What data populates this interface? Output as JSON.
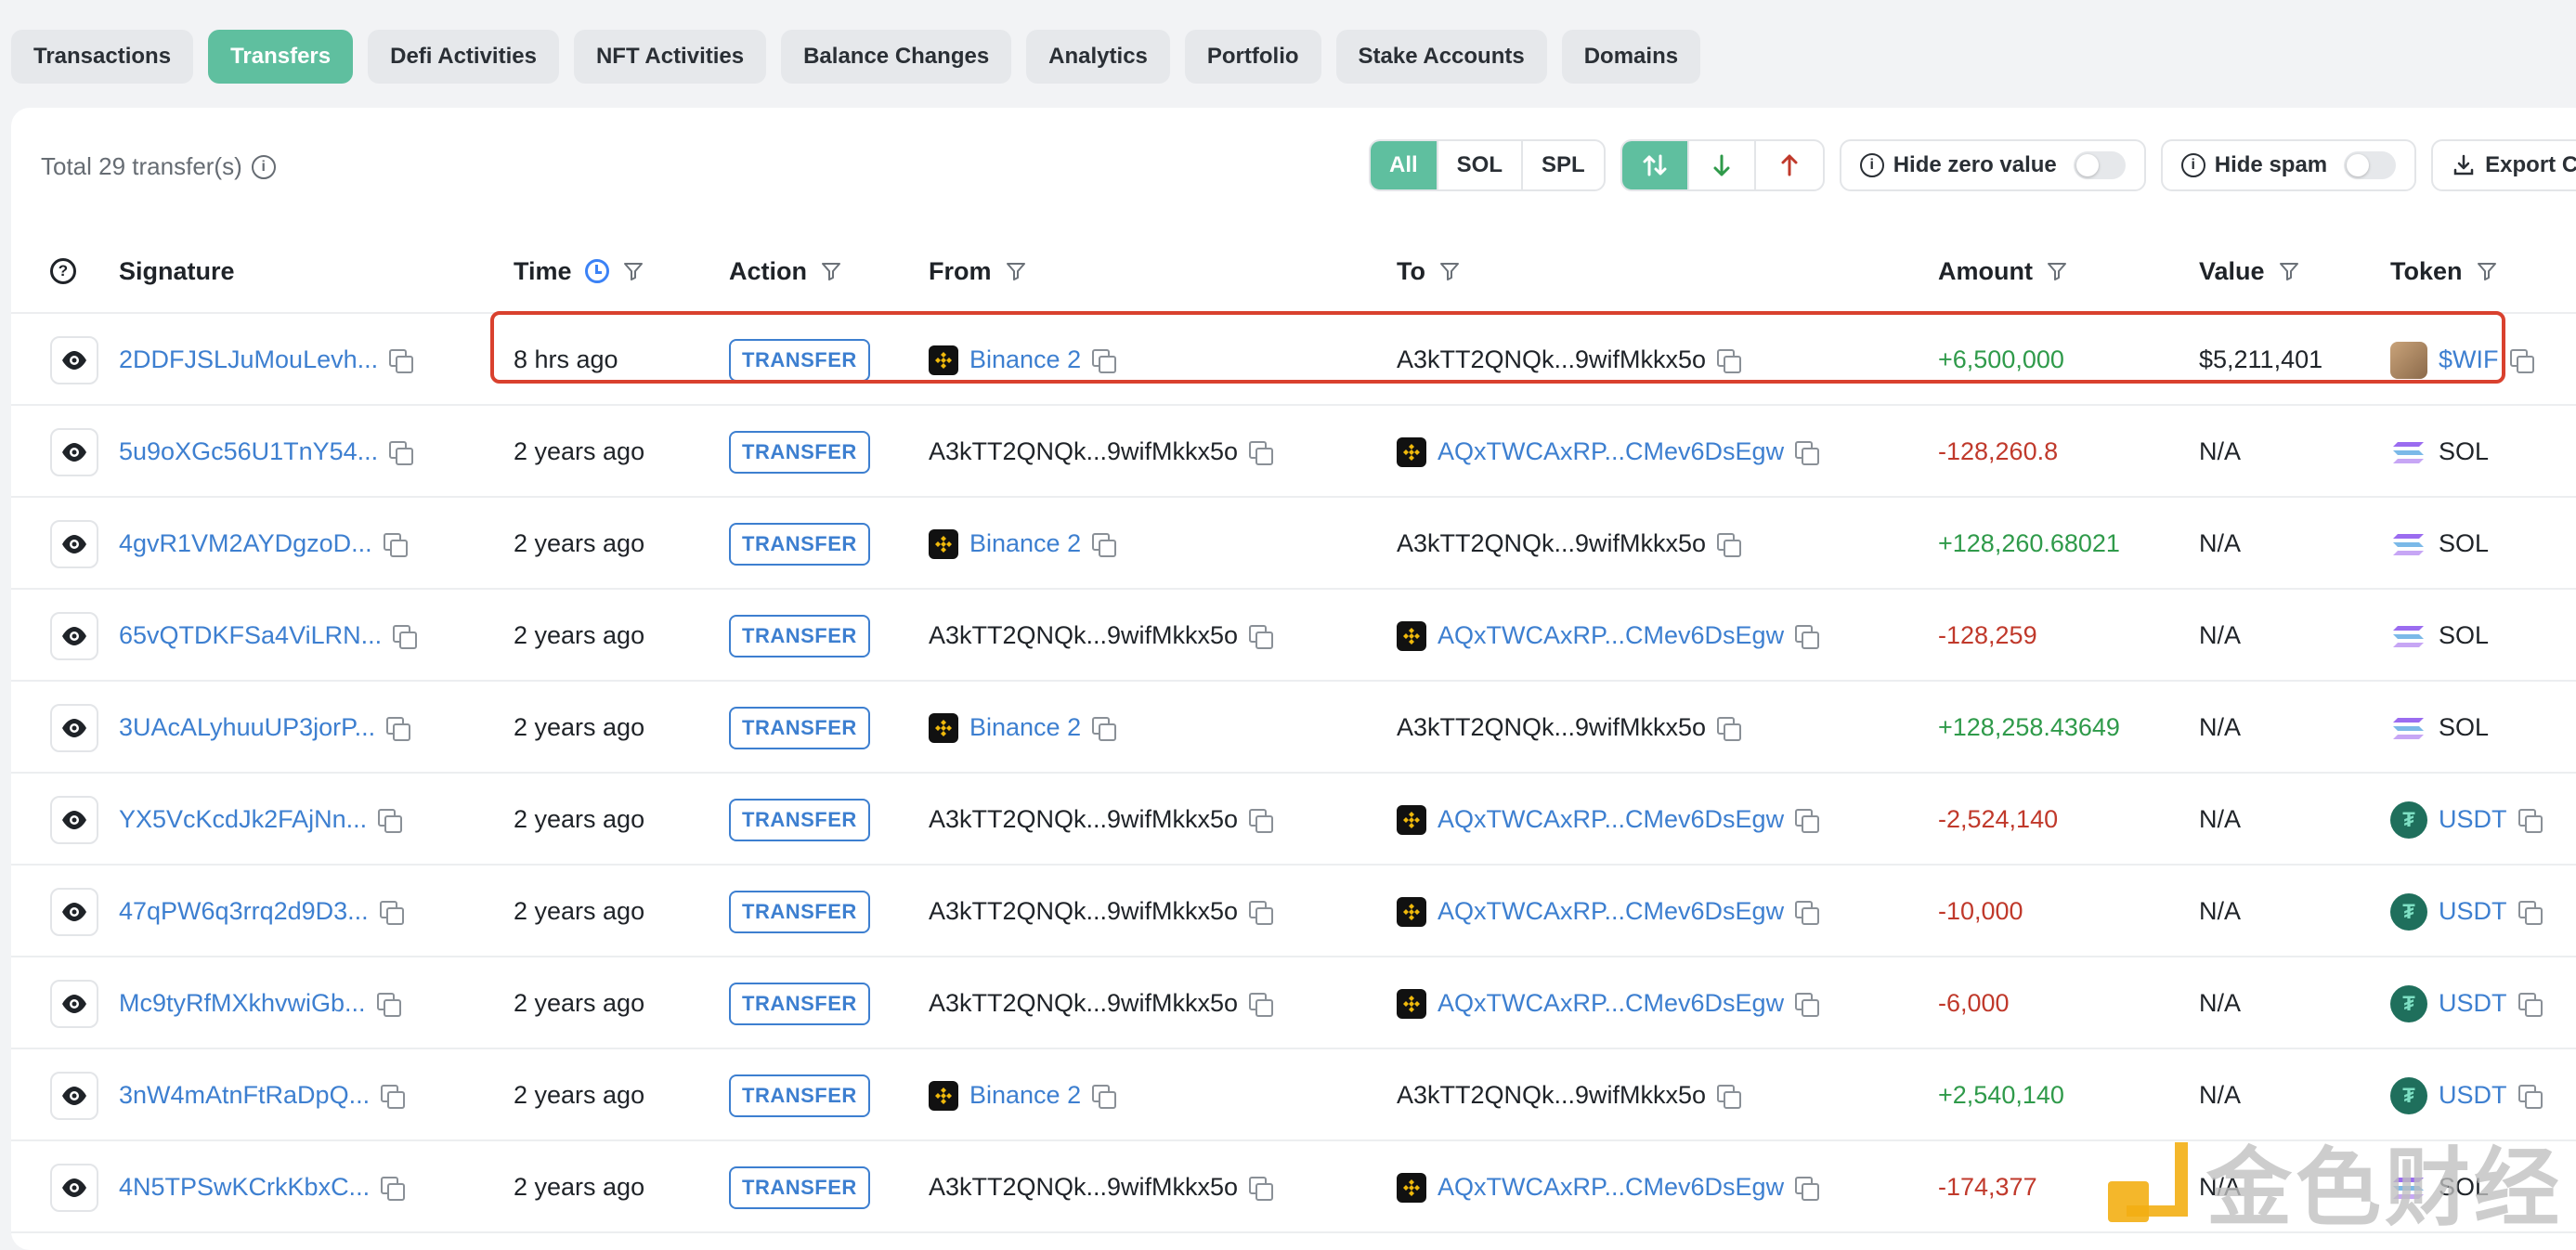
{
  "tabs": [
    {
      "label": "Transactions",
      "active": false
    },
    {
      "label": "Transfers",
      "active": true
    },
    {
      "label": "Defi Activities",
      "active": false
    },
    {
      "label": "NFT Activities",
      "active": false
    },
    {
      "label": "Balance Changes",
      "active": false
    },
    {
      "label": "Analytics",
      "active": false
    },
    {
      "label": "Portfolio",
      "active": false
    },
    {
      "label": "Stake Accounts",
      "active": false
    },
    {
      "label": "Domains",
      "active": false
    }
  ],
  "summary": {
    "total_text": "Total 29 transfer(s)"
  },
  "filters": {
    "token_types": [
      "All",
      "SOL",
      "SPL"
    ],
    "active_token_type": "All",
    "hide_zero_label": "Hide zero value",
    "hide_spam_label": "Hide spam",
    "export_label": "Export CSV"
  },
  "columns": {
    "signature": "Signature",
    "time": "Time",
    "action": "Action",
    "from": "From",
    "to": "To",
    "amount": "Amount",
    "value": "Value",
    "token": "Token"
  },
  "rows": [
    {
      "signature": "2DDFJSLJuMouLevh...",
      "time": "8 hrs ago",
      "action": "TRANSFER",
      "from": "Binance 2",
      "from_is_label": true,
      "to": "A3kTT2QNQk...9wifMkkx5o",
      "to_is_label": false,
      "amount": "+6,500,000",
      "value": "$5,211,401",
      "token": "$WIF",
      "token_kind": "wif"
    },
    {
      "signature": "5u9oXGc56U1TnY54...",
      "time": "2 years ago",
      "action": "TRANSFER",
      "from": "A3kTT2QNQk...9wifMkkx5o",
      "from_is_label": false,
      "to": "AQxTWCAxRP...CMev6DsEgw",
      "to_is_label": true,
      "amount": "-128,260.8",
      "value": "N/A",
      "token": "SOL",
      "token_kind": "sol"
    },
    {
      "signature": "4gvR1VM2AYDgzoD...",
      "time": "2 years ago",
      "action": "TRANSFER",
      "from": "Binance 2",
      "from_is_label": true,
      "to": "A3kTT2QNQk...9wifMkkx5o",
      "to_is_label": false,
      "amount": "+128,260.68021",
      "value": "N/A",
      "token": "SOL",
      "token_kind": "sol"
    },
    {
      "signature": "65vQTDKFSa4ViLRN...",
      "time": "2 years ago",
      "action": "TRANSFER",
      "from": "A3kTT2QNQk...9wifMkkx5o",
      "from_is_label": false,
      "to": "AQxTWCAxRP...CMev6DsEgw",
      "to_is_label": true,
      "amount": "-128,259",
      "value": "N/A",
      "token": "SOL",
      "token_kind": "sol"
    },
    {
      "signature": "3UAcALyhuuUP3jorP...",
      "time": "2 years ago",
      "action": "TRANSFER",
      "from": "Binance 2",
      "from_is_label": true,
      "to": "A3kTT2QNQk...9wifMkkx5o",
      "to_is_label": false,
      "amount": "+128,258.43649",
      "value": "N/A",
      "token": "SOL",
      "token_kind": "sol"
    },
    {
      "signature": "YX5VcKcdJk2FAjNn...",
      "time": "2 years ago",
      "action": "TRANSFER",
      "from": "A3kTT2QNQk...9wifMkkx5o",
      "from_is_label": false,
      "to": "AQxTWCAxRP...CMev6DsEgw",
      "to_is_label": true,
      "amount": "-2,524,140",
      "value": "N/A",
      "token": "USDT",
      "token_kind": "usdt"
    },
    {
      "signature": "47qPW6q3rrq2d9D3...",
      "time": "2 years ago",
      "action": "TRANSFER",
      "from": "A3kTT2QNQk...9wifMkkx5o",
      "from_is_label": false,
      "to": "AQxTWCAxRP...CMev6DsEgw",
      "to_is_label": true,
      "amount": "-10,000",
      "value": "N/A",
      "token": "USDT",
      "token_kind": "usdt"
    },
    {
      "signature": "Mc9tyRfMXkhvwiGb...",
      "time": "2 years ago",
      "action": "TRANSFER",
      "from": "A3kTT2QNQk...9wifMkkx5o",
      "from_is_label": false,
      "to": "AQxTWCAxRP...CMev6DsEgw",
      "to_is_label": true,
      "amount": "-6,000",
      "value": "N/A",
      "token": "USDT",
      "token_kind": "usdt"
    },
    {
      "signature": "3nW4mAtnFtRaDpQ...",
      "time": "2 years ago",
      "action": "TRANSFER",
      "from": "Binance 2",
      "from_is_label": true,
      "to": "A3kTT2QNQk...9wifMkkx5o",
      "to_is_label": false,
      "amount": "+2,540,140",
      "value": "N/A",
      "token": "USDT",
      "token_kind": "usdt"
    },
    {
      "signature": "4N5TPSwKCrkKbxC...",
      "time": "2 years ago",
      "action": "TRANSFER",
      "from": "A3kTT2QNQk...9wifMkkx5o",
      "from_is_label": false,
      "to": "AQxTWCAxRP...CMev6DsEgw",
      "to_is_label": true,
      "amount": "-174,377",
      "value": "N/A",
      "token": "SOL",
      "token_kind": "sol"
    }
  ],
  "watermark": {
    "text": "金色财经"
  },
  "colors": {
    "accent": "#5fbf9f",
    "link": "#3d7fd0",
    "positive": "#2f9a4a",
    "negative": "#c0392b",
    "highlight": "#d9412e"
  }
}
